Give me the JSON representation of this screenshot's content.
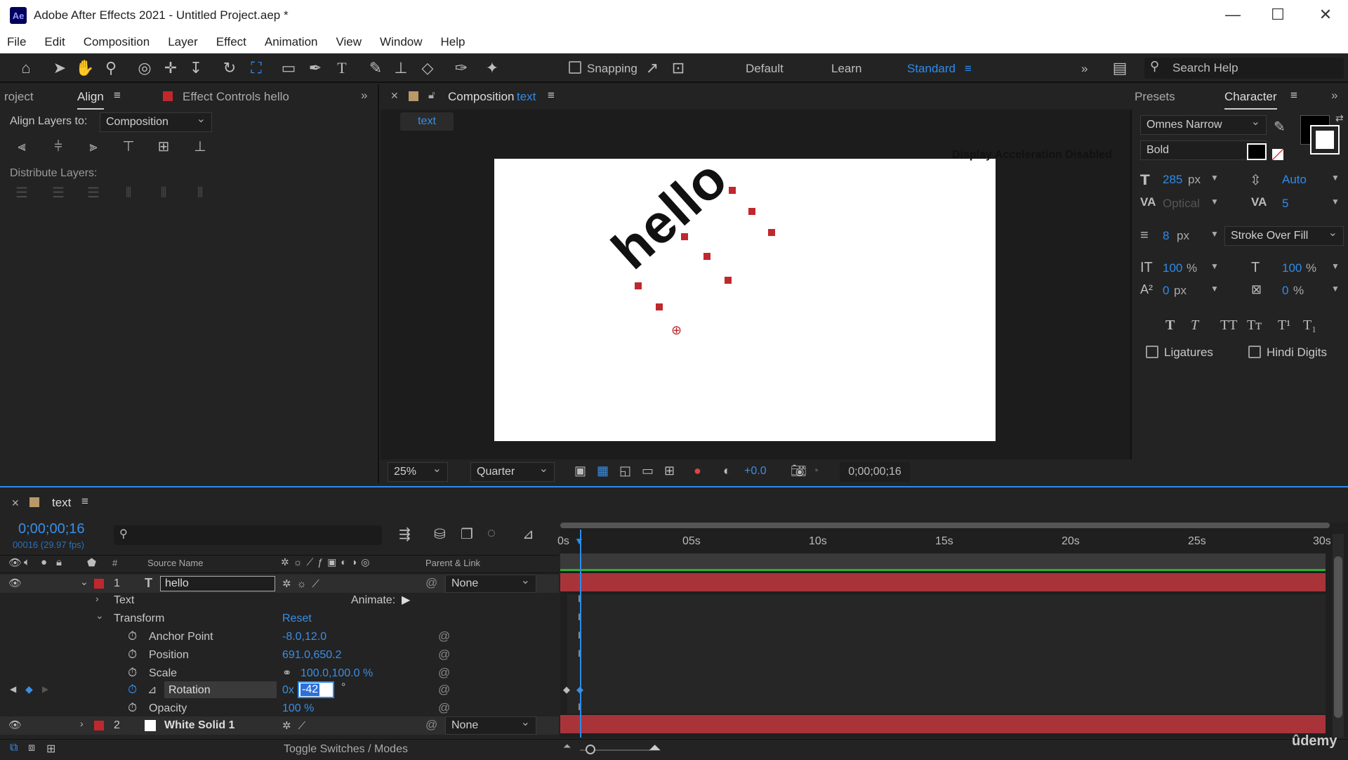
{
  "window": {
    "app_icon": "Ae",
    "title": "Adobe After Effects 2021 - Untitled Project.aep *",
    "minimize": "—",
    "maximize": "☐",
    "close": "✕"
  },
  "menu": [
    "File",
    "Edit",
    "Composition",
    "Layer",
    "Effect",
    "Animation",
    "View",
    "Window",
    "Help"
  ],
  "toolbar": {
    "snapping": "Snapping",
    "workspaces": [
      "Default",
      "Learn",
      "Standard"
    ],
    "active_workspace": "Standard",
    "search_placeholder": "Search Help"
  },
  "left_panel": {
    "tabs": [
      "roject",
      "Align",
      "Effect Controls hello"
    ],
    "active_tab": "Align",
    "align_layers_to_label": "Align Layers to:",
    "align_layers_to_value": "Composition",
    "distribute_label": "Distribute Layers:"
  },
  "composition_panel": {
    "tab_label": "Composition",
    "tab_name": "text",
    "breadcrumb": "text",
    "notice": "Display Acceleration Disabled",
    "canvas_text": "hello",
    "zoom": "25%",
    "resolution": "Quarter",
    "exposure": "+0.0",
    "timecode": "0;00;00;16"
  },
  "character_panel": {
    "tabs": [
      "Presets",
      "Character"
    ],
    "active_tab": "Character",
    "font": "Omnes Narrow",
    "style": "Bold",
    "font_size": "285",
    "font_size_unit": "px",
    "leading": "Auto",
    "kerning": "Optical",
    "tracking": "5",
    "stroke_width": "8",
    "stroke_unit": "px",
    "stroke_type": "Stroke Over Fill",
    "vscale": "100",
    "hscale": "100",
    "pct": "%",
    "baseline": "0",
    "baseline_unit": "px",
    "tsume": "0",
    "tsume_unit": "%",
    "style_buttons": [
      "T",
      "T",
      "TT",
      "Tт",
      "T¹",
      "T₁"
    ],
    "ligatures": "Ligatures",
    "hindi_digits": "Hindi Digits",
    "fill_color": "#000000",
    "stroke_color": "#ffffff"
  },
  "timeline": {
    "comp_name": "text",
    "timecode": "0;00;00;16",
    "frame_info": "00016 (29.97 fps)",
    "col_source_name": "Source Name",
    "col_parent": "Parent & Link",
    "col_num": "#",
    "ruler": [
      "0s",
      "05s",
      "10s",
      "15s",
      "20s",
      "25s",
      "30s"
    ],
    "layers": [
      {
        "num": "1",
        "name": "hello",
        "parent": "None",
        "color": "#c0282d"
      },
      {
        "num": "2",
        "name": "White Solid 1",
        "parent": "None",
        "color": "#c0282d"
      }
    ],
    "text_group": "Text",
    "animate_label": "Animate:",
    "transform_group": "Transform",
    "reset": "Reset",
    "properties": [
      {
        "name": "Anchor Point",
        "value": "-8.0,12.0"
      },
      {
        "name": "Position",
        "value": "691.0,650.2"
      },
      {
        "name": "Scale",
        "value": "100.0,100.0 %"
      },
      {
        "name": "Rotation",
        "value": "0x",
        "edit_value": "-42",
        "unit": "°"
      },
      {
        "name": "Opacity",
        "value": "100 %"
      }
    ],
    "toggle_label": "Toggle Switches / Modes"
  },
  "watermark": "ûdemy",
  "colors": {
    "accent": "#2d8ceb",
    "layer_bar": "#a8343a",
    "label_red": "#c0282d",
    "work_area": "#2bb02b"
  }
}
